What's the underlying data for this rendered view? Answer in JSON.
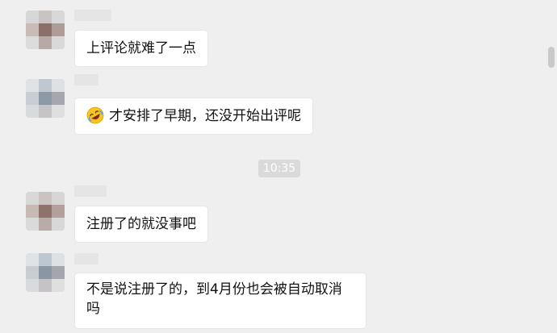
{
  "colors": {
    "background": "#efefef",
    "bubble": "#ffffff",
    "text": "#111111",
    "timestamp_bg": "#dadada"
  },
  "messages": [
    {
      "text": "上评论就难了一点"
    },
    {
      "emoji": "rolling-on-the-floor-laughing",
      "text": "才安排了早期，还没开始出评呢"
    },
    {
      "text": "注册了的就没事吧"
    },
    {
      "text": "不是说注册了的，到4月份也会被自动取消吗"
    }
  ],
  "timestamp": "10:35"
}
